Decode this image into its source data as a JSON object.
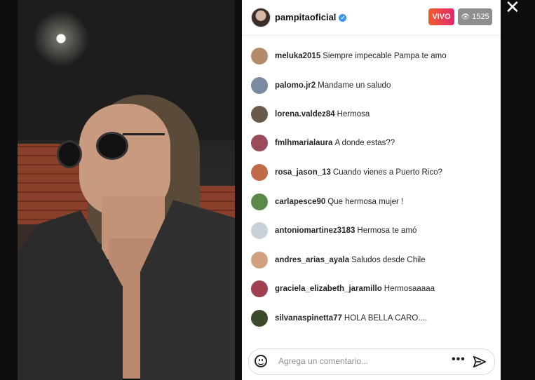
{
  "stream": {
    "username": "pampitaoficial",
    "live_label": "VIVO",
    "viewer_count": "1525"
  },
  "comments": [
    {
      "user": "meluka2015",
      "text": "Siempre impecable Pampa te amo",
      "avatar_color": "#b58a6a"
    },
    {
      "user": "palomo.jr2",
      "text": "Mandame un saludo",
      "avatar_color": "#7a8aa0"
    },
    {
      "user": "lorena.valdez84",
      "text": "Hermosa",
      "avatar_color": "#6a5a4a"
    },
    {
      "user": "fmlhmarialaura",
      "text": "A donde estas??",
      "avatar_color": "#9a4a5a"
    },
    {
      "user": "rosa_jason_13",
      "text": "Cuando vienes a Puerto Rico?",
      "avatar_color": "#c06a4a"
    },
    {
      "user": "carlapesce90",
      "text": "Que hermosa mujer !",
      "avatar_color": "#5a8a4a"
    },
    {
      "user": "antoniomartinez3183",
      "text": "Hermosa te amó",
      "avatar_color": "#c8d0da"
    },
    {
      "user": "andres_arias_ayala",
      "text": "Saludos desde Chile",
      "avatar_color": "#d0a080"
    },
    {
      "user": "graciela_elizabeth_jaramillo",
      "text": "Hermosaaaaa",
      "avatar_color": "#a04050"
    },
    {
      "user": "silvanaspinetta77",
      "text": "HOLA BELLA CARO....",
      "avatar_color": "#3a4a2a"
    }
  ],
  "input": {
    "placeholder": "Agrega un comentario..."
  },
  "icons": {
    "emoji": "emoji-icon",
    "more": "more-options-icon",
    "send": "send-icon",
    "close": "close-icon",
    "eye": "eye-icon",
    "verified": "verified-badge-icon"
  },
  "colors": {
    "live_gradient_start": "#f25a2b",
    "live_gradient_end": "#e4286e",
    "viewer_badge": "#8e8e8e",
    "verified": "#3897f0"
  }
}
